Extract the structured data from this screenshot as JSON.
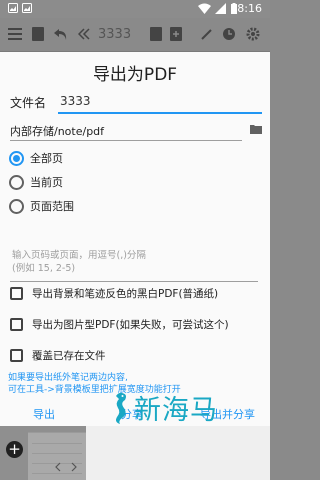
{
  "status_bar": {
    "time": "8:16"
  },
  "toolbar": {
    "page_text": "3333"
  },
  "dialog": {
    "title": "导出为PDF",
    "file_name_label": "文件名",
    "file_name_value": "3333",
    "path": "内部存储/note/pdf",
    "radios": [
      {
        "label": "全部页",
        "selected": true
      },
      {
        "label": "当前页",
        "selected": false
      },
      {
        "label": "页面范围",
        "selected": false
      }
    ],
    "pages_hint_line1": "输入页码或页面，用逗号(,)分隔",
    "pages_hint_line2": "(例如 15, 2-5)",
    "checkboxes": [
      {
        "label": "导出背景和笔迹反色的黑白PDF(普通纸)",
        "checked": false
      },
      {
        "label": "导出为图片型PDF(如果失败，可尝试这个)",
        "checked": false
      },
      {
        "label": "覆盖已存在文件",
        "checked": false
      }
    ],
    "note_line1": "如果要导出纸外笔记两边内容,",
    "note_line2": "可在工具->背景模板里把扩展宽度功能打开",
    "actions": {
      "export": "导出",
      "share": "分享",
      "export_share": "导出并分享"
    }
  },
  "watermark": {
    "text": "新海马"
  },
  "colors": {
    "accent": "#2196f3",
    "dim_overlay": "#8a8a8a"
  }
}
